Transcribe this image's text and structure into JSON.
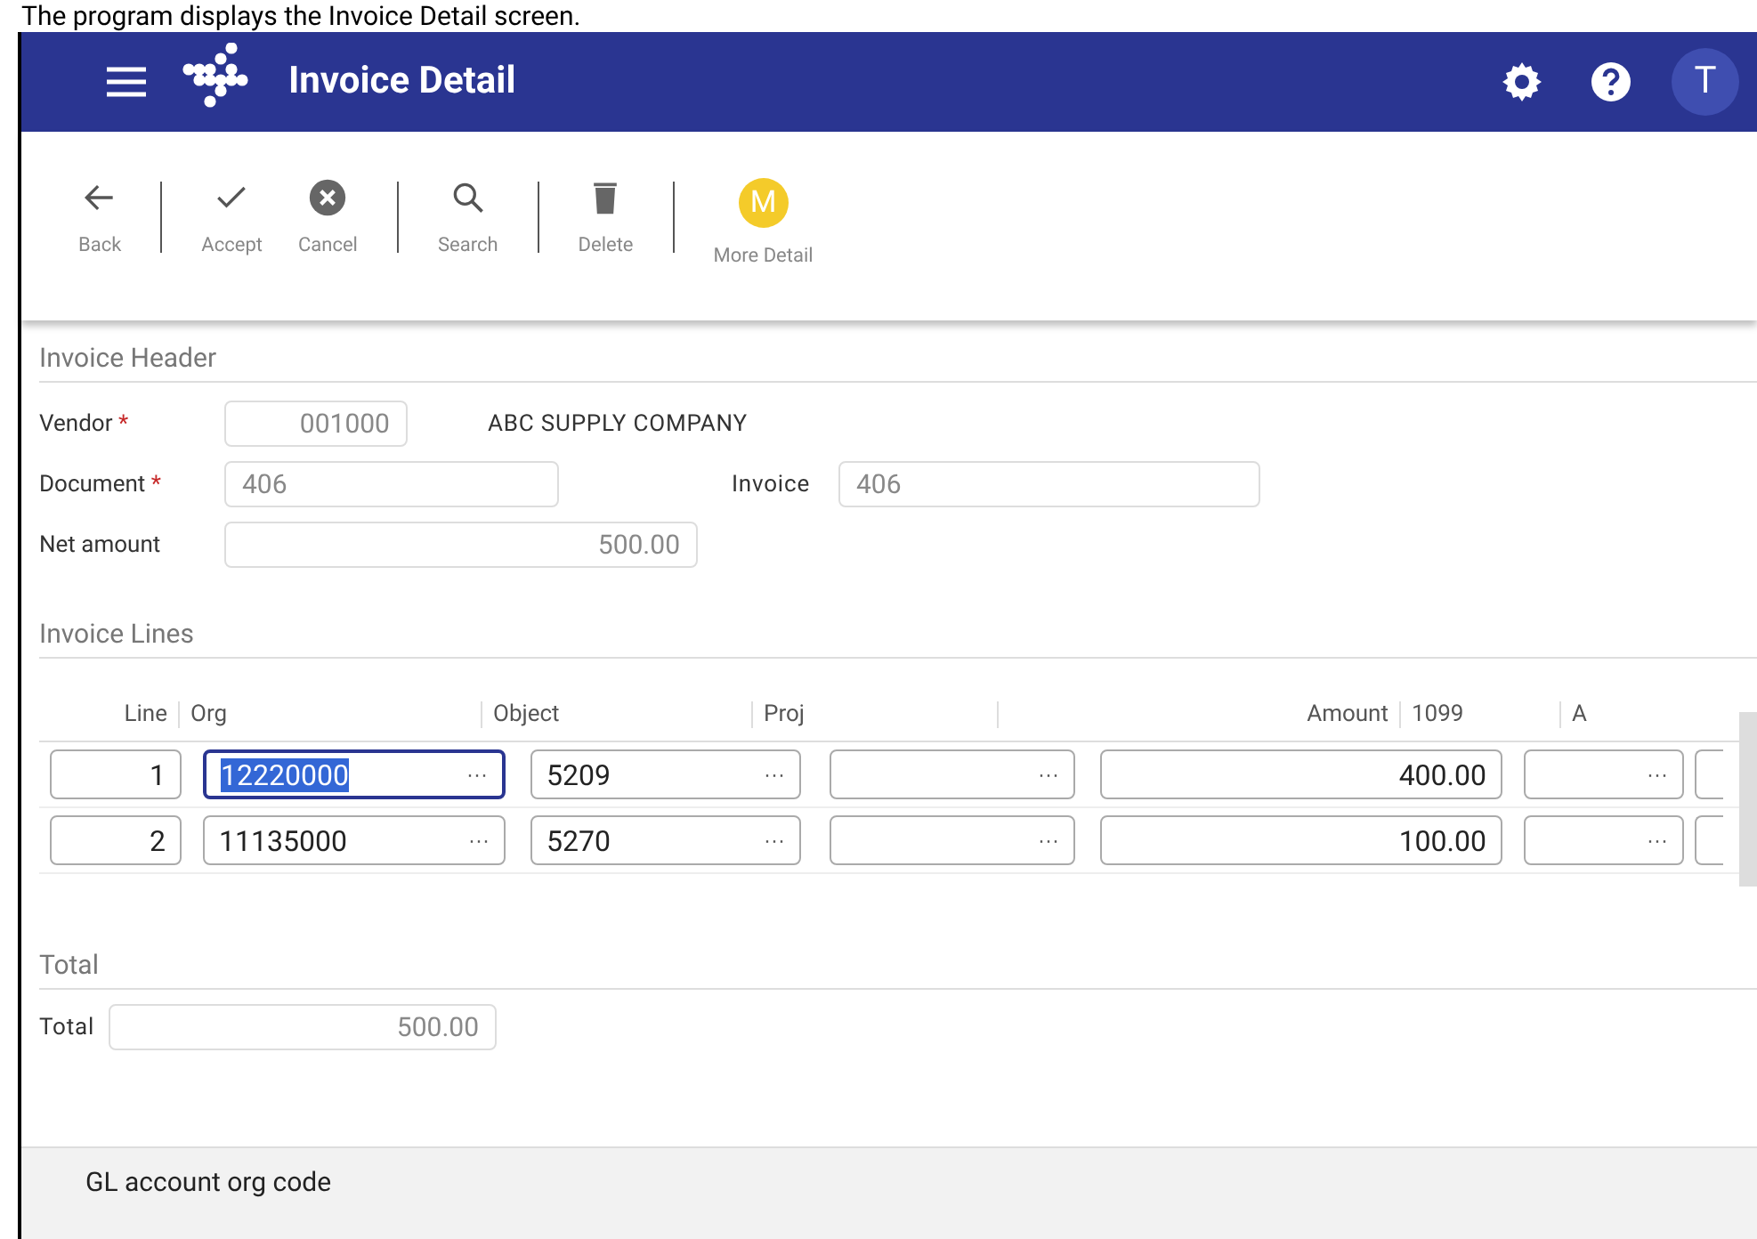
{
  "caption": "The program displays the Invoice Detail screen.",
  "app_bar": {
    "title": "Invoice Detail",
    "avatar": "T"
  },
  "toolbar": [
    {
      "label": "Back",
      "kind": "back",
      "divider_after": true
    },
    {
      "label": "Accept",
      "kind": "accept",
      "divider_after": false
    },
    {
      "label": "Cancel",
      "kind": "cancel",
      "divider_after": true
    },
    {
      "label": "Search",
      "kind": "search",
      "divider_after": true
    },
    {
      "label": "Delete",
      "kind": "delete",
      "divider_after": true
    },
    {
      "label": "More Detail",
      "kind": "more",
      "badge": "M",
      "divider_after": false
    }
  ],
  "header": {
    "title": "Invoice Header",
    "vendor_label": "Vendor",
    "vendor": "001000",
    "vendor_name": "ABC SUPPLY COMPANY",
    "document_label": "Document",
    "document": "406",
    "invoice_label": "Invoice",
    "invoice": "406",
    "net_label": "Net amount",
    "net": "500.00",
    "required_mark": "*"
  },
  "lines": {
    "title": "Invoice Lines",
    "columns": [
      "Line",
      "Org",
      "Object",
      "Proj",
      "Amount",
      "1099",
      "A"
    ],
    "rows": [
      {
        "line": "1",
        "org": "12220000",
        "org_focused": true,
        "object": "5209",
        "proj": "",
        "amount": "400.00"
      },
      {
        "line": "2",
        "org": "11135000",
        "org_focused": false,
        "object": "5270",
        "proj": "",
        "amount": "100.00"
      }
    ],
    "lookup": "···"
  },
  "total": {
    "title": "Total",
    "label": "Total",
    "value": "500.00"
  },
  "status_bar": {
    "text": "GL account org code"
  }
}
